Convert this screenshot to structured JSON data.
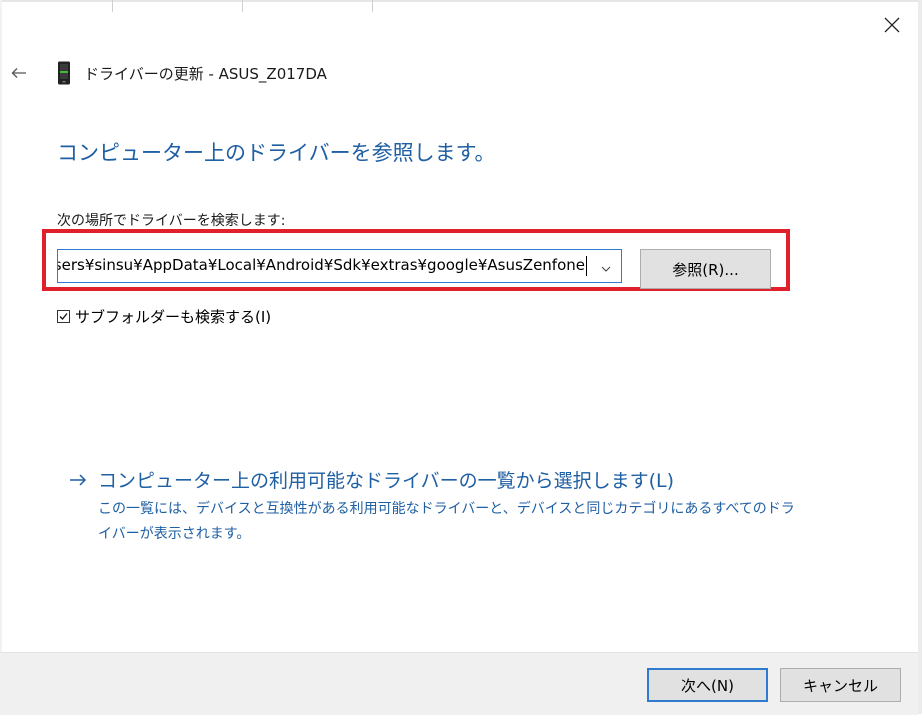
{
  "window": {
    "title": "ドライバーの更新 - ASUS_Z017DA",
    "icons": {
      "close": "close-icon",
      "back": "back-arrow-icon",
      "device": "phone-device-icon"
    }
  },
  "main": {
    "heading": "コンピューター上のドライバーを参照します。",
    "search_label": "次の場所でドライバーを検索します:",
    "path_value": "C:¥Users¥sinsu¥AppData¥Local¥Android¥Sdk¥extras¥google¥AsusZenfone",
    "browse_label": "参照(R)...",
    "include_subfolders_label": "サブフォルダーも検索する(I)",
    "include_subfolders_checked": true,
    "pick_link_label": "コンピューター上の利用可能なドライバーの一覧から選択します(L)",
    "pick_description": "この一覧には、デバイスと互換性がある利用可能なドライバーと、デバイスと同じカテゴリにあるすべてのドライバーが表示されます。"
  },
  "footer": {
    "next_label": "次へ(N)",
    "cancel_label": "キャンセル"
  },
  "colors": {
    "accent_blue": "#1f5fa3",
    "input_border": "#2f7bd0",
    "highlight_red": "#e0202a",
    "footer_bg": "#f0f0f0"
  }
}
